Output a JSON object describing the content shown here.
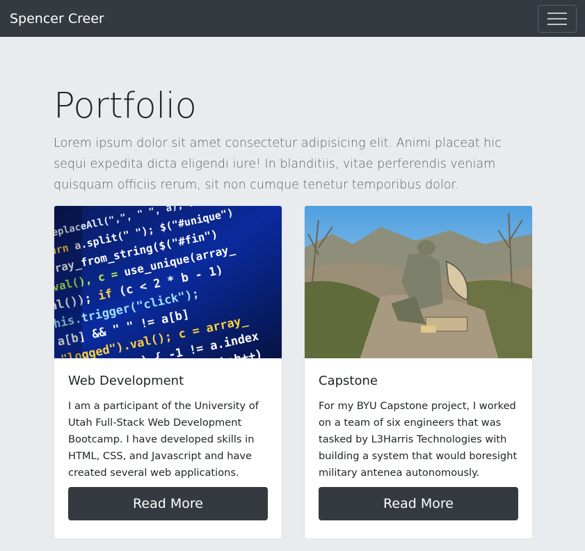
{
  "navbar": {
    "brand": "Spencer Creer",
    "toggle_icon": "hamburger-menu-icon"
  },
  "hero": {
    "title": "Portfolio",
    "lead": "Lorem ipsum dolor sit amet consectetur adipisicing elit. Animi placeat hic sequi expedita dicta eligendi iure! In blanditiis, vitae perferendis veniam quisquam officiis rerum, sit non cumque tenetur temporibus dolor."
  },
  "projects": [
    {
      "title": "Web Development",
      "text": "I am a participant of the University of Utah Full-Stack Web Development Bootcamp. I have developed skills in HTML, CSS, and Javascript and have created several web applications.",
      "button": "Read More",
      "image": "code-screen-photo"
    },
    {
      "title": "Capstone",
      "text": "For my BYU Capstone project, I worked on a team of six engineers that was tasked by L3Harris Technologies with building a system that would boresight military antenea autonomously.",
      "button": "Read More",
      "image": "soldier-with-antenna-photo"
    }
  ],
  "colors": {
    "navbar_bg": "#343a40",
    "page_bg": "#e9ecef",
    "button_bg": "#343a40"
  }
}
